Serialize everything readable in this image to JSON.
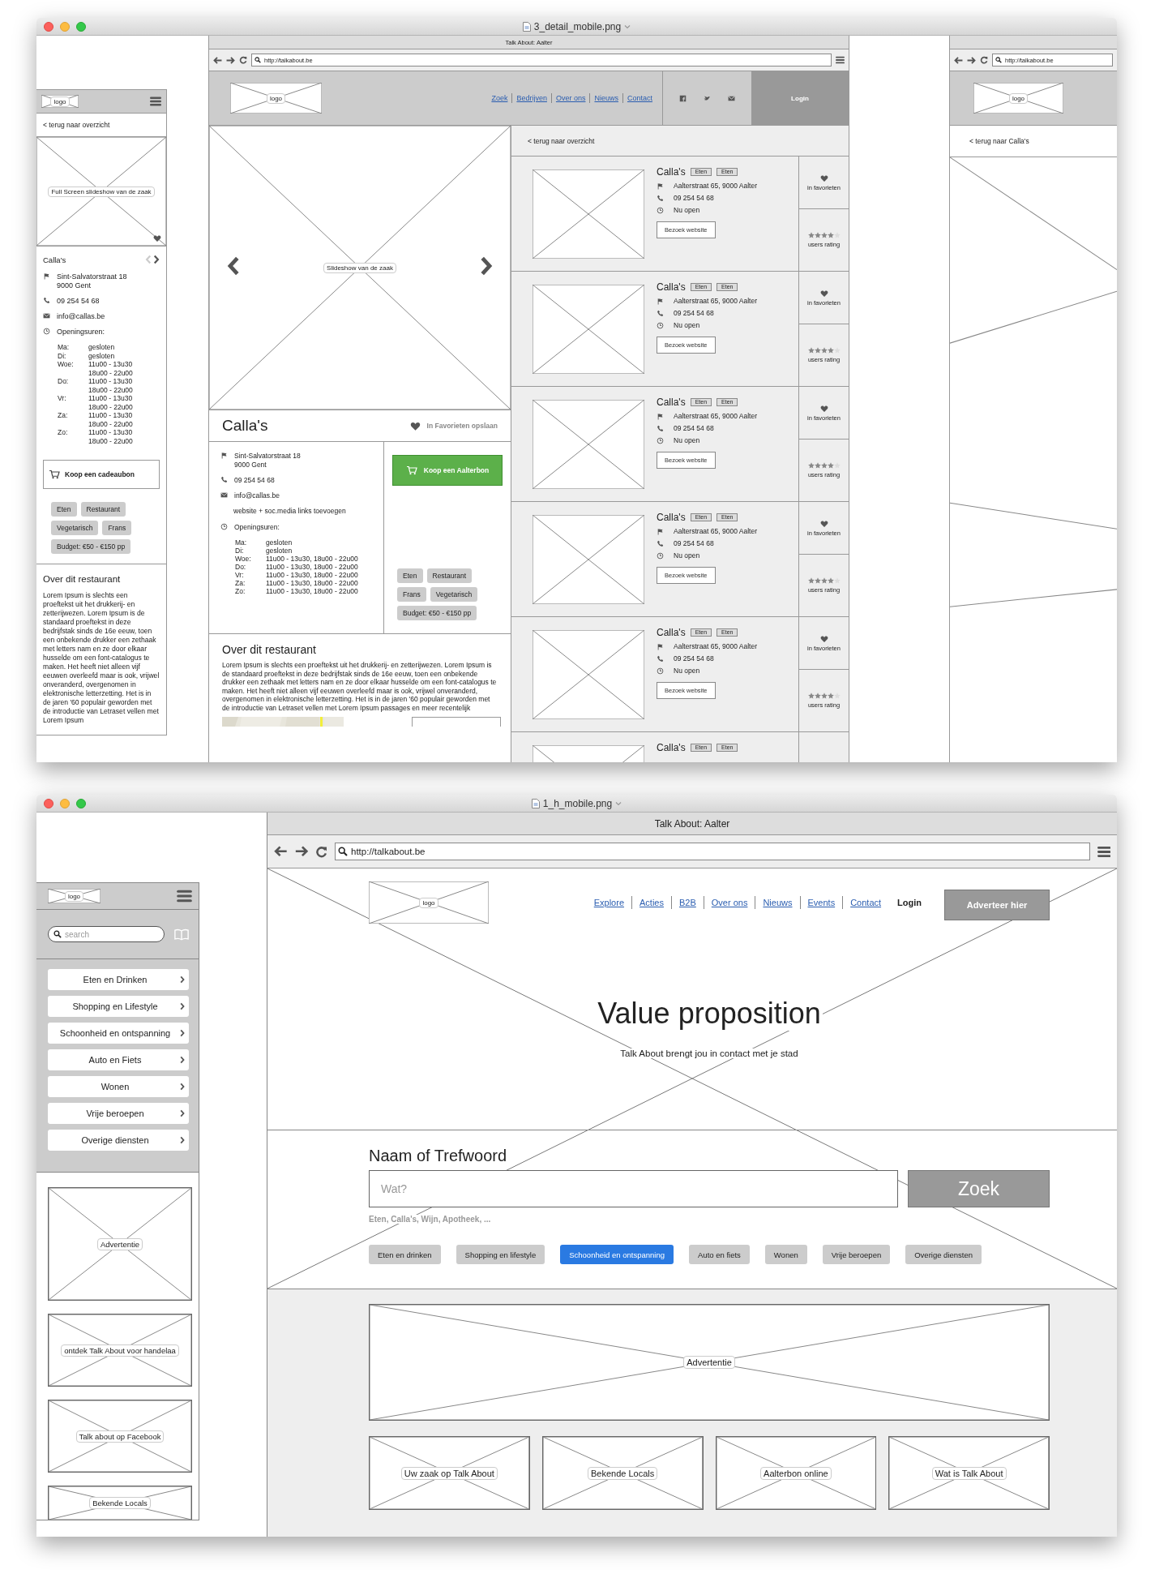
{
  "detail_window": {
    "title": "3_detail_mobile.png",
    "mobile": {
      "logo": "logo",
      "back_link": "< terug naar overzicht",
      "slideshow_label": "Full Screen slideshow van de zaak",
      "prev_disabled": true,
      "next_disabled": false,
      "name": "Calla's",
      "address": [
        "Sint-Salvatorstraat 18",
        "9000 Gent"
      ],
      "phone": "09 254 54 68",
      "email": "info@callas.be",
      "hours_label": "Openingsuren:",
      "hours": [
        {
          "day": "Ma:",
          "times": [
            "gesloten"
          ]
        },
        {
          "day": "Di:",
          "times": [
            "gesloten"
          ]
        },
        {
          "day": "Woe:",
          "times": [
            "11u00 - 13u30",
            "18u00 - 22u00"
          ]
        },
        {
          "day": "Do:",
          "times": [
            "11u00 - 13u30",
            "18u00 - 22u00"
          ]
        },
        {
          "day": "Vr:",
          "times": [
            "11u00 - 13u30",
            "18u00 - 22u00"
          ]
        },
        {
          "day": "Za:",
          "times": [
            "11u00 - 13u30",
            "18u00 - 22u00"
          ]
        },
        {
          "day": "Zo:",
          "times": [
            "11u00 - 13u30",
            "18u00 - 22u00"
          ]
        }
      ],
      "gift_button": "Koop een cadeaubon",
      "tags": [
        "Eten",
        "Restaurant",
        "Vegetarisch",
        "Frans",
        "Budget: €50 - €150 pp"
      ],
      "about_title": "Over dit restaurant",
      "about_text": "Lorem Ipsum is slechts een proeftekst uit het drukkerij- en zetterijwezen. Lorem Ipsum is de standaard proeftekst in deze bedrijfstak sinds de 16e eeuw, toen een onbekende drukker een zethaak met letters nam en ze door elkaar husselde om een font-catalogus te maken. Het heeft niet alleen vijf eeuwen overleefd maar is ook, vrijwel onveranderd, overgenomen in elektronische letterzetting. Het is in de jaren '60 populair geworden met de introductie van Letraset vellen met Lorem Ipsum"
    },
    "desktop": {
      "page_title": "Talk About: Aalter",
      "url": "http://talkabout.be",
      "logo": "logo",
      "nav": [
        "Zoek",
        "Bedrijven",
        "Over ons",
        "Nieuws",
        "Contact"
      ],
      "login": "Login",
      "slideshow_label": "Slideshow van de zaak",
      "name": "Calla's",
      "favorite": "In Favorieten opslaan",
      "address": [
        "Sint-Salvatorstraat 18",
        "9000 Gent"
      ],
      "phone": "09 254 54 68",
      "email": "info@callas.be",
      "links_note": "website + soc.media links toevoegen",
      "hours_label": "Openingsuren:",
      "hours": [
        {
          "day": "Ma:",
          "times": "gesloten"
        },
        {
          "day": "Di:",
          "times": "gesloten"
        },
        {
          "day": "Woe:",
          "times": "11u00 - 13u30, 18u00 - 22u00"
        },
        {
          "day": "Do:",
          "times": "11u00 - 13u30, 18u00 - 22u00"
        },
        {
          "day": "Vr:",
          "times": "11u00 - 13u30, 18u00 - 22u00"
        },
        {
          "day": "Za:",
          "times": "11u00 - 13u30, 18u00 - 22u00"
        },
        {
          "day": "Zo:",
          "times": "11u00 - 13u30, 18u00 - 22u00"
        }
      ],
      "buy_button": "Koop een Aalterbon",
      "tags": [
        "Eten",
        "Restaurant",
        "Frans",
        "Vegetarisch",
        "Budget: €50 - €150 pp"
      ],
      "about_title": "Over dit restaurant",
      "about_text": "Lorem Ipsum is slechts een proeftekst uit het drukkerij- en zetterijwezen. Lorem Ipsum is de standaard proeftekst in deze bedrijfstak sinds de 16e eeuw, toen een onbekende drukker een zethaak met letters nam en ze door elkaar husselde om een font-catalogus te maken. Het heeft niet alleen vijf eeuwen overleefd maar is ook, vrijwel onveranderd, overgenomen in elektronische letterzetting. Het is in de jaren '60 populair geworden met de introductie van Letraset vellen met Lorem Ipsum passages en meer recentelijk",
      "map": {
        "kind": "picture"
      }
    },
    "results": {
      "back_link": "< terug naar overzicht",
      "items": [
        {
          "name": "Calla's",
          "tags": [
            "Eten",
            "Eten"
          ],
          "address": "Aalterstraat 65, 9000 Aalter",
          "phone": "09 254 54 68",
          "status": "Nu open",
          "button": "Bezoek website",
          "favorite": "in favorieten",
          "stars": 4,
          "rating_label": "users rating"
        },
        {
          "name": "Calla's",
          "tags": [
            "Eten",
            "Eten"
          ],
          "address": "Aalterstraat 65, 9000 Aalter",
          "phone": "09 254 54 68",
          "status": "Nu open",
          "button": "Bezoek website",
          "favorite": "in favorieten",
          "stars": 4,
          "rating_label": "users rating"
        },
        {
          "name": "Calla's",
          "tags": [
            "Eten",
            "Eten"
          ],
          "address": "Aalterstraat 65, 9000 Aalter",
          "phone": "09 254 54 68",
          "status": "Nu open",
          "button": "Bezoek website",
          "favorite": "in favorieten",
          "stars": 4,
          "rating_label": "users rating"
        },
        {
          "name": "Calla's",
          "tags": [
            "Eten",
            "Eten"
          ],
          "address": "Aalterstraat 65, 9000 Aalter",
          "phone": "09 254 54 68",
          "status": "Nu open",
          "button": "Bezoek website",
          "favorite": "in favorieten",
          "stars": 4,
          "rating_label": "users rating"
        },
        {
          "name": "Calla's",
          "tags": [
            "Eten",
            "Eten"
          ],
          "address": "Aalterstraat 65, 9000 Aalter",
          "phone": "09 254 54 68",
          "status": "Nu open",
          "button": "Bezoek website",
          "favorite": "in favorieten",
          "stars": 4,
          "rating_label": "users rating"
        },
        {
          "name": "Calla's",
          "tags": [
            "Eten",
            "Eten"
          ]
        }
      ]
    },
    "preview": {
      "url": "http://talkabout.be",
      "logo": "logo",
      "back_link": "< terug naar Calla's"
    }
  },
  "home_window": {
    "title": "1_h_mobile.png",
    "mobile": {
      "logo": "logo",
      "search_placeholder": "search",
      "categories": [
        "Eten en Drinken",
        "Shopping en Lifestyle",
        "Schoonheid en ontspanning",
        "Auto en Fiets",
        "Wonen",
        "Vrije beroepen",
        "Overige diensten"
      ],
      "ads": [
        "Advertentie",
        "ontdek Talk About voor handelaa",
        "Talk about op Facebook",
        "Bekende Locals"
      ]
    },
    "desktop": {
      "page_title": "Talk About: Aalter",
      "url": "http://talkabout.be",
      "logo": "logo",
      "nav": [
        "Explore",
        "Acties",
        "B2B",
        "Over ons",
        "Nieuws",
        "Events",
        "Contact"
      ],
      "login": "Login",
      "cta": "Adverteer hier",
      "headline": "Value proposition",
      "subline": "Talk About brengt jou in contact met je stad",
      "search_label": "Naam of Trefwoord",
      "search_placeholder": "Wat?",
      "search_button": "Zoek",
      "search_hint": "Eten, Calla's, Wijn, Apotheek, ...",
      "filters": [
        {
          "label": "Eten en drinken",
          "selected": false
        },
        {
          "label": "Shopping en lifestyle",
          "selected": false
        },
        {
          "label": "Schoonheid en ontspanning",
          "selected": true
        },
        {
          "label": "Auto en fiets",
          "selected": false
        },
        {
          "label": "Wonen",
          "selected": false
        },
        {
          "label": "Vrije beroepen",
          "selected": false
        },
        {
          "label": "Overige diensten",
          "selected": false
        }
      ],
      "ad_label": "Advertentie",
      "tiles": [
        "Uw zaak op Talk About",
        "Bekende Locals",
        "Aalterbon online",
        "Wat is Talk About"
      ]
    }
  }
}
